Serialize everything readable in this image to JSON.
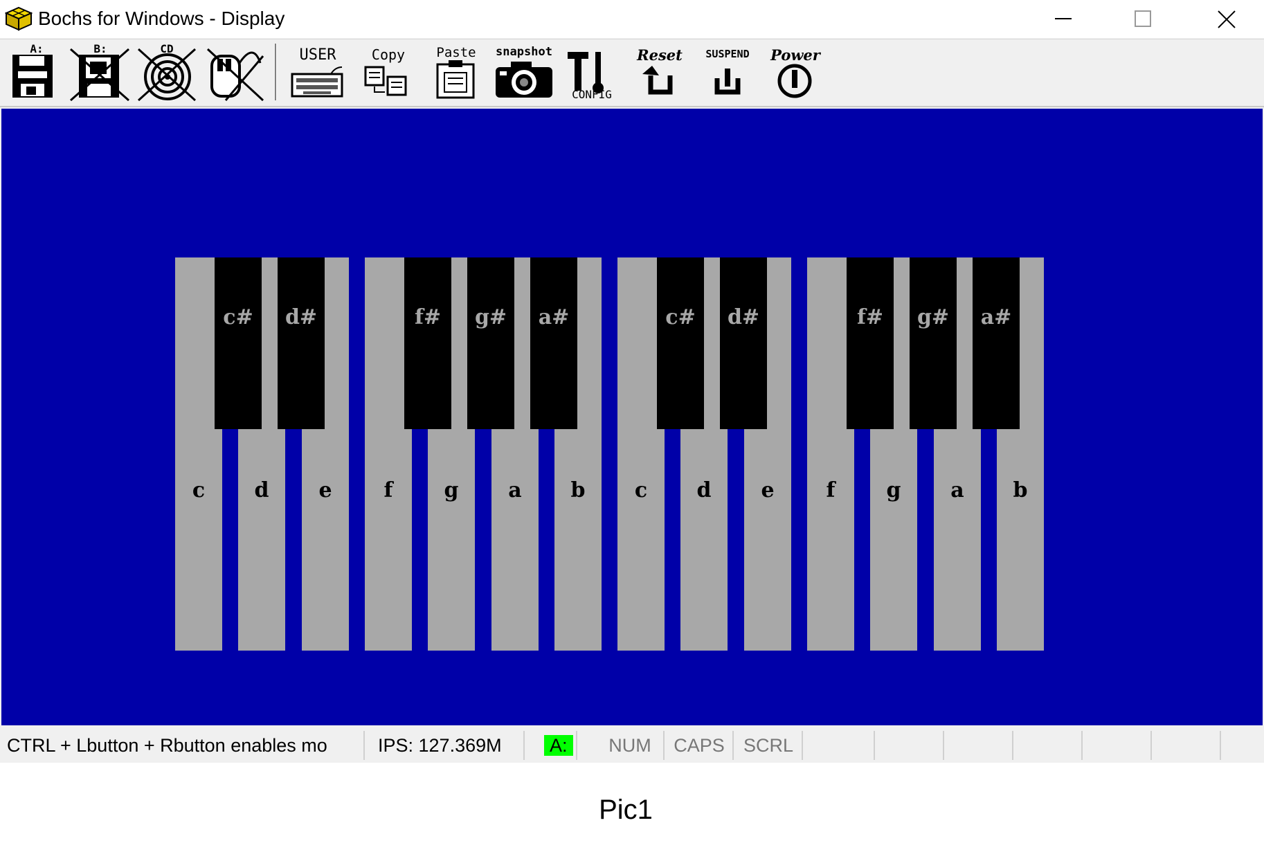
{
  "window": {
    "title": "Bochs for Windows - Display",
    "icon": "bochs-cube-icon"
  },
  "toolbar": {
    "floppy_a_label": "A:",
    "floppy_b_label": "B:",
    "cdrom_label": "CD",
    "user_label": "USER",
    "copy_label": "Copy",
    "paste_label": "Paste",
    "snapshot_label": "snapshot",
    "config_label": "CONFIG",
    "reset_label": "Reset",
    "suspend_label": "SUSPEND",
    "power_label": "Power"
  },
  "keyboard": {
    "white_keys": [
      "c",
      "d",
      "e",
      "f",
      "g",
      "a",
      "b",
      "c",
      "d",
      "e",
      "f",
      "g",
      "a",
      "b"
    ],
    "black_keys": [
      "c#",
      "d#",
      "f#",
      "g#",
      "a#",
      "c#",
      "d#",
      "f#",
      "g#",
      "a#"
    ],
    "colors": {
      "background": "#0000a8",
      "white_key": "#a8a8a8",
      "black_key": "#000000"
    }
  },
  "statusbar": {
    "message": "CTRL + Lbutton + Rbutton enables mo",
    "ips": "IPS: 127.369M",
    "drive": "A:",
    "num": "NUM",
    "caps": "CAPS",
    "scrl": "SCRL",
    "drive_color": "#00ff00"
  },
  "caption": "Pic1"
}
